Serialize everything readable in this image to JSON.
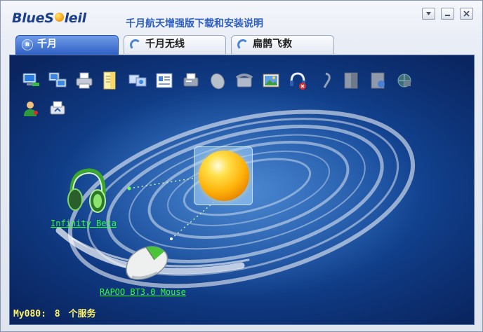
{
  "app": {
    "logo_text": "BlueS",
    "logo_text_tail": "leil",
    "title": "千月航天增强版下载和安装说明"
  },
  "window_controls": [
    "minimize",
    "maximize",
    "close"
  ],
  "tabs": [
    {
      "label": "千月",
      "icon": "bluetooth-icon",
      "active": true
    },
    {
      "label": "千月无线",
      "icon": "signal-icon",
      "active": false
    },
    {
      "label": "扁鹊飞救",
      "icon": "signal-icon",
      "active": false
    }
  ],
  "toolbar_icons": [
    "network-access-icon",
    "lan-access-icon",
    "printer-icon",
    "file-transfer-icon",
    "file-sync-icon",
    "business-card-icon",
    "fax-icon",
    "mouse-service-icon",
    "phone-dialup-icon",
    "image-transfer-icon",
    "headset-icon",
    "earpiece-icon",
    "dock-icon",
    "sync-document-icon",
    "network-sphere-icon",
    "personal-area-icon",
    "print-share-icon"
  ],
  "devices": [
    {
      "name": "Infinity Beta",
      "icon": "headphones-icon"
    },
    {
      "name": "RAPOO BT3.0 Mouse",
      "icon": "mouse-icon"
    }
  ],
  "status": {
    "device_name": "My080:",
    "service_count": "8",
    "service_label": "个服务"
  },
  "colors": {
    "accent": "#2f60c4",
    "canvas": "#144a9c",
    "device_label": "#2cff3a",
    "status_text": "#fff36a"
  }
}
